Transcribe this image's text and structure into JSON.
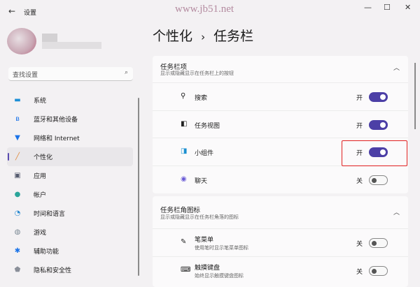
{
  "window": {
    "title": "设置",
    "back": "←",
    "min": "—",
    "max": "☐",
    "close": "✕"
  },
  "watermark": "www.jb51.net",
  "search": {
    "placeholder": "查找设置",
    "icon": "⌕"
  },
  "nav": [
    {
      "label": "系统",
      "icon": "▬",
      "color": "#1d8fd6"
    },
    {
      "label": "蓝牙和其他设备",
      "icon": "ʙ",
      "color": "#1a73e8"
    },
    {
      "label": "网络和 Internet",
      "icon": "▼",
      "color": "#1a73e8"
    },
    {
      "label": "个性化",
      "icon": "╱",
      "color": "#e08a3c",
      "selected": true
    },
    {
      "label": "应用",
      "icon": "▣",
      "color": "#555b6e"
    },
    {
      "label": "帐户",
      "icon": "●",
      "color": "#2aa59a"
    },
    {
      "label": "时间和语言",
      "icon": "◔",
      "color": "#2a8ad0"
    },
    {
      "label": "游戏",
      "icon": "◍",
      "color": "#7a8894"
    },
    {
      "label": "辅助功能",
      "icon": "✱",
      "color": "#1a73e8"
    },
    {
      "label": "隐私和安全性",
      "icon": "⬟",
      "color": "#8a8f99"
    }
  ],
  "breadcrumb": {
    "parent": "个性化",
    "sep": "›",
    "current": "任务栏"
  },
  "sections": [
    {
      "title": "任务栏项",
      "subtitle": "显示或隐藏显示在任务栏上的按钮",
      "chevron": "︿",
      "items": [
        {
          "label": "搜索",
          "icon": "⚲",
          "state": "开",
          "on": true
        },
        {
          "label": "任务视图",
          "icon": "◧",
          "state": "开",
          "on": true
        },
        {
          "label": "小组件",
          "icon": "◨",
          "state": "开",
          "on": true
        },
        {
          "label": "聊天",
          "icon": "◉",
          "state": "关",
          "on": false
        }
      ]
    },
    {
      "title": "任务栏角图标",
      "subtitle": "显示或隐藏显示在任务栏角落的图标",
      "chevron": "︿",
      "items": [
        {
          "label": "笔菜单",
          "desc": "使用笔时显示笔菜单图标",
          "icon": "✎",
          "state": "关",
          "on": false
        },
        {
          "label": "触摸键盘",
          "desc": "始终显示触摸键盘图标",
          "icon": "⌨",
          "state": "关",
          "on": false
        }
      ]
    }
  ]
}
